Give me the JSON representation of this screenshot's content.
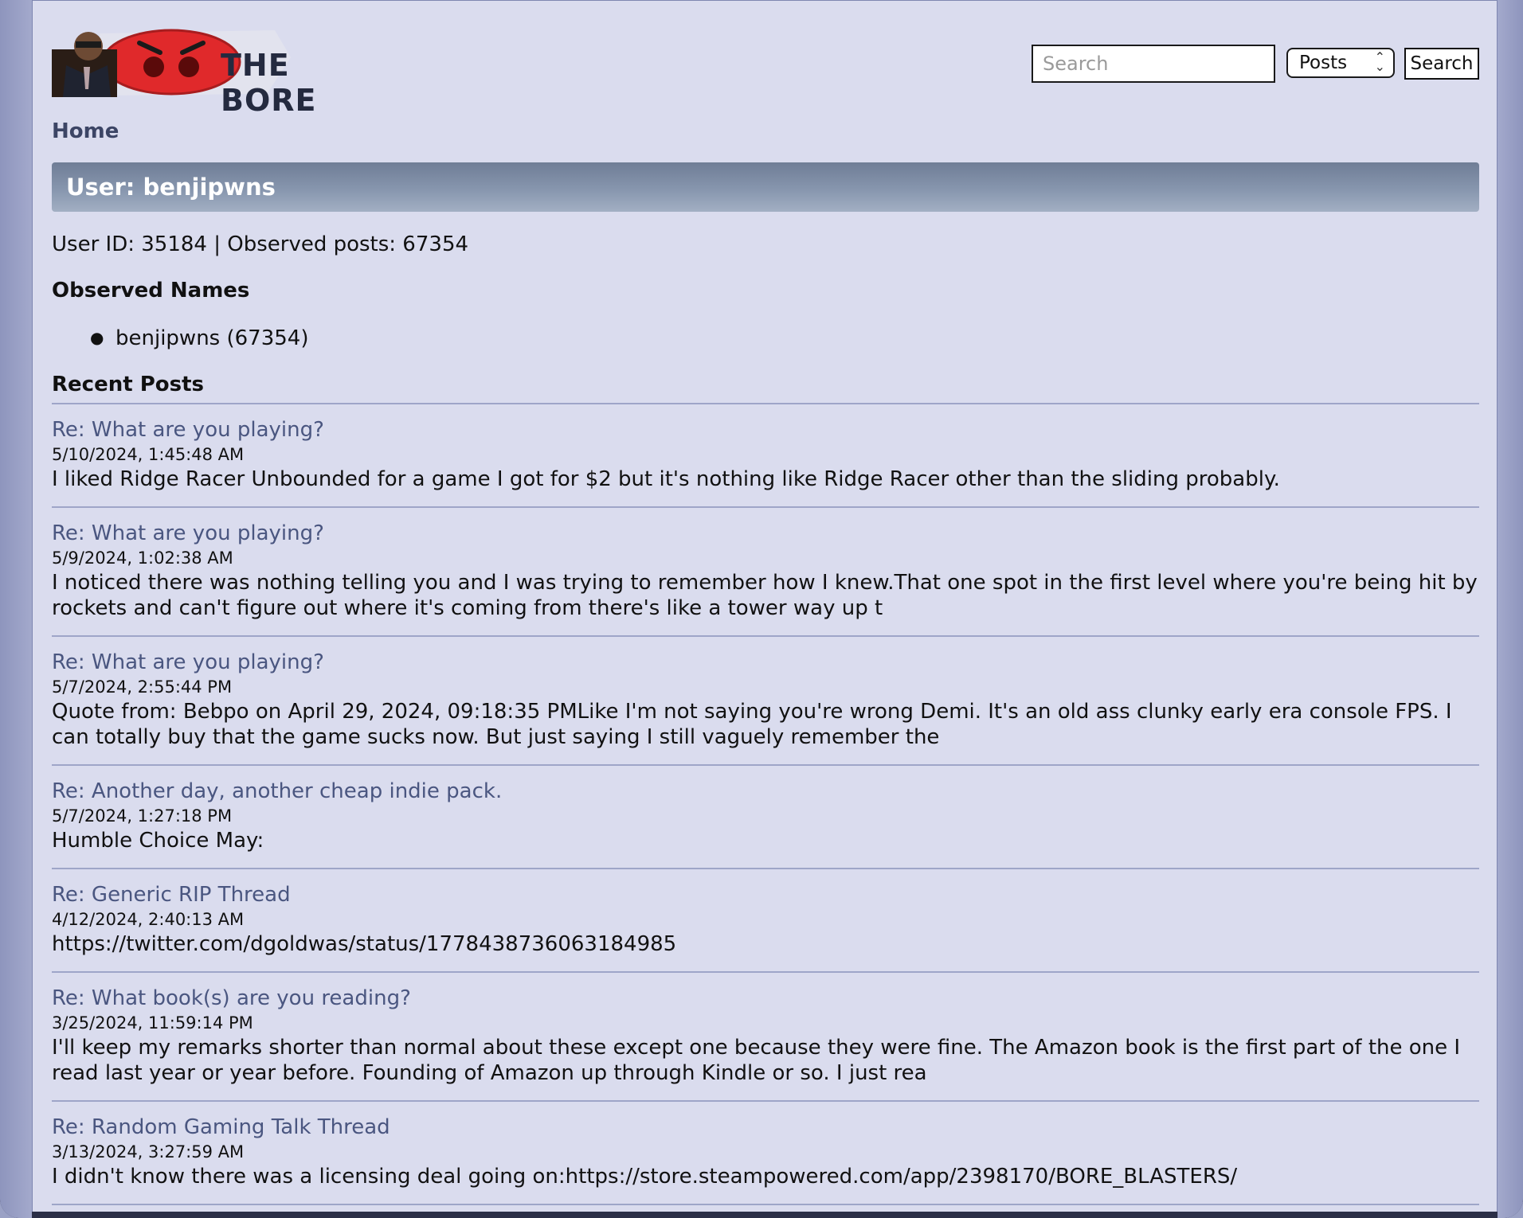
{
  "site": {
    "logo_text": "THE BORE",
    "search_placeholder": "Search",
    "search_scope": "Posts",
    "search_button": "Search",
    "nav_home": "Home"
  },
  "user": {
    "heading": "User: benjipwns",
    "meta": "User ID: 35184 | Observed posts: 67354",
    "observed_names_heading": "Observed Names",
    "observed_names": [
      "benjipwns (67354)"
    ]
  },
  "recent_posts_heading": "Recent Posts",
  "posts": [
    {
      "title": "Re: What are you playing?",
      "date": "5/10/2024, 1:45:48 AM",
      "body": "I liked Ridge Racer Unbounded for a game I got for $2 but it's nothing like Ridge Racer other than the sliding probably."
    },
    {
      "title": "Re: What are you playing?",
      "date": "5/9/2024, 1:02:38 AM",
      "body": "I noticed there was nothing telling you and I was trying to remember how I knew.That one spot in the first level where you're being hit by rockets and can't figure out where it's coming from there's like a tower way up t"
    },
    {
      "title": "Re: What are you playing?",
      "date": "5/7/2024, 2:55:44 PM",
      "body": "Quote from: Bebpo on April 29, 2024, 09:18:35 PMLike I'm not saying you're wrong Demi. It's an old ass clunky early era console FPS. I can totally buy that the game sucks now. But just saying I still vaguely remember the"
    },
    {
      "title": "Re: Another day, another cheap indie pack.",
      "date": "5/7/2024, 1:27:18 PM",
      "body": "Humble Choice May:"
    },
    {
      "title": "Re: Generic RIP Thread",
      "date": "4/12/2024, 2:40:13 AM",
      "body": "https://twitter.com/dgoldwas/status/1778438736063184985"
    },
    {
      "title": "Re: What book(s) are you reading?",
      "date": "3/25/2024, 11:59:14 PM",
      "body": "I'll keep my remarks shorter than normal about these except one because they were fine. The Amazon book is the first part of the one I read last year or year before. Founding of Amazon up through Kindle or so. I just rea"
    },
    {
      "title": "Re: Random Gaming Talk Thread",
      "date": "3/13/2024, 3:27:59 AM",
      "body": "I didn't know there was a licensing deal going on:https://store.steampowered.com/app/2398170/BORE_BLASTERS/"
    }
  ]
}
